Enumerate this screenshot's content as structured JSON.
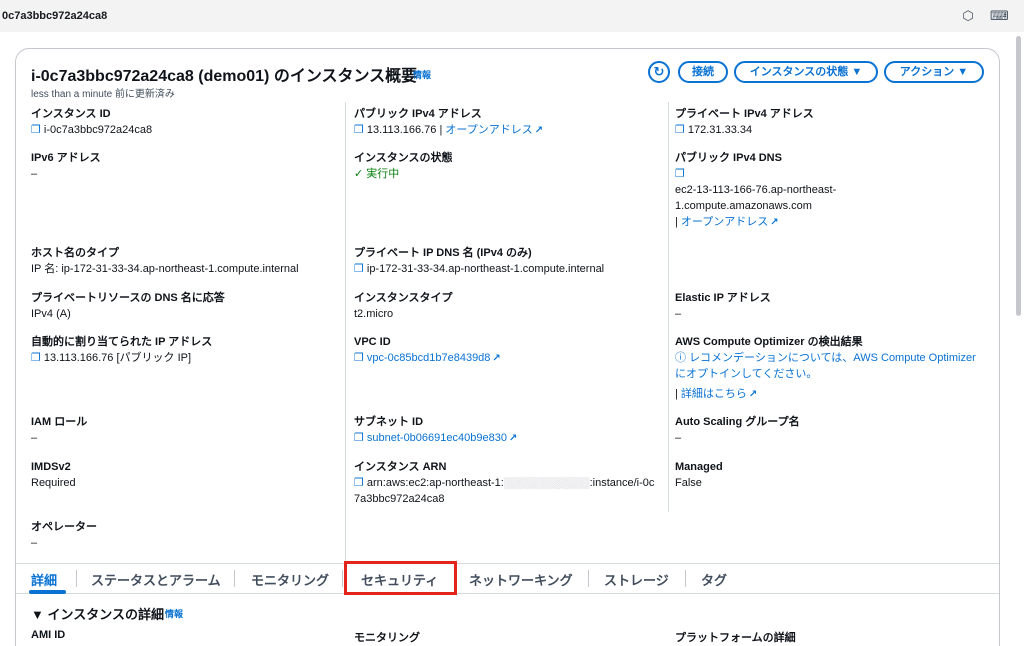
{
  "topbar": {
    "title": "0c7a3bbc972a24ca8"
  },
  "icons": {
    "shortcut": "⬡",
    "terminal": "⌨",
    "refresh": "↻",
    "copy": "❐",
    "external": "↗",
    "check": "✓",
    "info": "ⓘ"
  },
  "header": {
    "title": "i-0c7a3bbc972a24ca8 (demo01) のインスタンス概要",
    "info": "情報",
    "updated": "less than a minute 前に更新済み",
    "connect": "接続",
    "instance_state": "インスタンスの状態 ▼",
    "actions": "アクション ▼"
  },
  "fields": {
    "instance_id": {
      "label": "インスタンス ID",
      "value": "i-0c7a3bbc972a24ca8"
    },
    "public_ipv4": {
      "label": "パブリック IPv4 アドレス",
      "value": "13.113.166.76",
      "sep": " | ",
      "link": "オープンアドレス"
    },
    "private_ipv4": {
      "label": "プライベート IPv4 アドレス",
      "value": "172.31.33.34"
    },
    "ipv6": {
      "label": "IPv6 アドレス",
      "value": "–"
    },
    "state": {
      "label": "インスタンスの状態",
      "value": "実行中"
    },
    "public_dns": {
      "label": "パブリック IPv4 DNS",
      "line1": "ec2-13-113-166-76.ap-northeast-",
      "line2": "1.compute.amazonaws.com",
      "sep": "| ",
      "link": "オープンアドレス"
    },
    "hostname_type": {
      "label": "ホスト名のタイプ",
      "value": "IP 名: ip-172-31-33-34.ap-northeast-1.compute.internal"
    },
    "private_dns": {
      "label": "プライベート IP DNS 名 (IPv4 のみ)",
      "value": "ip-172-31-33-34.ap-northeast-1.compute.internal"
    },
    "resource_dns": {
      "label": "プライベートリソースの DNS 名に応答",
      "value": "IPv4 (A)"
    },
    "instance_type": {
      "label": "インスタンスタイプ",
      "value": "t2.micro"
    },
    "elastic_ip": {
      "label": "Elastic IP アドレス",
      "value": "–"
    },
    "auto_ip": {
      "label": "自動的に割り当てられた IP アドレス",
      "value": "13.113.166.76 [パブリック IP]"
    },
    "vpc": {
      "label": "VPC ID",
      "value": "vpc-0c85bcd1b7e8439d8"
    },
    "optimizer": {
      "label": "AWS Compute Optimizer の検出結果",
      "line1": "レコメンデーションについては、AWS Compute Optimizer",
      "line2": "にオプトインしてください。",
      "sep": "| ",
      "link": "詳細はこちら"
    },
    "iam": {
      "label": "IAM ロール",
      "value": "–"
    },
    "subnet": {
      "label": "サブネット ID",
      "value": "subnet-0b06691ec40b9e830"
    },
    "asg": {
      "label": "Auto Scaling グループ名",
      "value": "–"
    },
    "imds": {
      "label": "IMDSv2",
      "value": "Required"
    },
    "arn": {
      "label": "インスタンス ARN",
      "line1": "arn:aws:ec2:ap-northeast-1:",
      "masked": "▒▒▒▒▒▒▒▒▒▒▒",
      "line1b": ":instance/i-0c",
      "line2": "7a3bbc972a24ca8"
    },
    "managed": {
      "label": "Managed",
      "value": "False"
    },
    "operator": {
      "label": "オペレーター",
      "value": "–"
    }
  },
  "tabs": [
    "詳細",
    "ステータスとアラーム",
    "モニタリング",
    "セキュリティ",
    "ネットワーキング",
    "ストレージ",
    "タグ"
  ],
  "section": {
    "title": "▼ インスタンスの詳細",
    "info": "情報",
    "ami": "AMI ID",
    "monitoring": "モニタリング",
    "platform": "プラットフォームの詳細"
  }
}
